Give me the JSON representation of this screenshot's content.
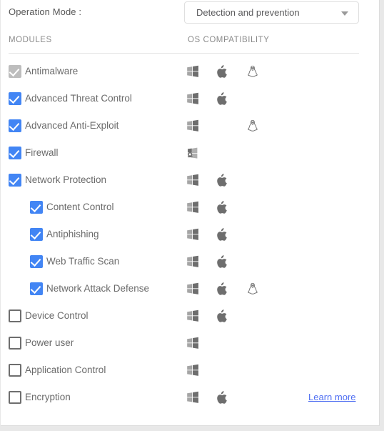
{
  "operation_mode": {
    "label": "Operation Mode :",
    "selected": "Detection and prevention"
  },
  "columns": {
    "modules": "MODULES",
    "os_compatibility": "OS COMPATIBILITY"
  },
  "colors": {
    "checked": "#4285f4",
    "disabled_checked": "#bdbdbd",
    "link": "#4e6ef2",
    "label_text": "#6a6a6a",
    "header_text": "#8b8b8b",
    "icon": "#6e6e6e",
    "panel_bg": "#ffffff",
    "page_bg": "#e8e8e8"
  },
  "modules": [
    {
      "name": "Antimalware",
      "level": 0,
      "state": "disabled-checked",
      "os": [
        "windows",
        "mac",
        "linux"
      ],
      "link": null
    },
    {
      "name": "Advanced Threat Control",
      "level": 0,
      "state": "checked",
      "os": [
        "windows",
        "mac"
      ],
      "link": null
    },
    {
      "name": "Advanced Anti-Exploit",
      "level": 0,
      "state": "checked",
      "os": [
        "windows",
        "linux"
      ],
      "link": null
    },
    {
      "name": "Firewall",
      "level": 0,
      "state": "checked",
      "os": [
        "windows-firewall"
      ],
      "link": null
    },
    {
      "name": "Network Protection",
      "level": 0,
      "state": "checked",
      "os": [
        "windows",
        "mac"
      ],
      "link": null
    },
    {
      "name": "Content Control",
      "level": 1,
      "state": "checked",
      "os": [
        "windows",
        "mac"
      ],
      "link": null
    },
    {
      "name": "Antiphishing",
      "level": 1,
      "state": "checked",
      "os": [
        "windows",
        "mac"
      ],
      "link": null
    },
    {
      "name": "Web Traffic Scan",
      "level": 1,
      "state": "checked",
      "os": [
        "windows",
        "mac"
      ],
      "link": null
    },
    {
      "name": "Network Attack Defense",
      "level": 1,
      "state": "checked",
      "os": [
        "windows",
        "mac",
        "linux"
      ],
      "link": null
    },
    {
      "name": "Device Control",
      "level": 0,
      "state": "unchecked",
      "os": [
        "windows",
        "mac"
      ],
      "link": null
    },
    {
      "name": "Power user",
      "level": 0,
      "state": "unchecked",
      "os": [
        "windows"
      ],
      "link": null
    },
    {
      "name": "Application Control",
      "level": 0,
      "state": "unchecked",
      "os": [
        "windows"
      ],
      "link": null
    },
    {
      "name": "Encryption",
      "level": 0,
      "state": "unchecked",
      "os": [
        "windows",
        "mac"
      ],
      "link": "Learn more"
    }
  ],
  "icons": {
    "windows": "windows-icon",
    "mac": "apple-icon",
    "linux": "linux-penguin-icon",
    "windows-firewall": "windows-firewall-icon",
    "caret": "chevron-down-icon"
  }
}
